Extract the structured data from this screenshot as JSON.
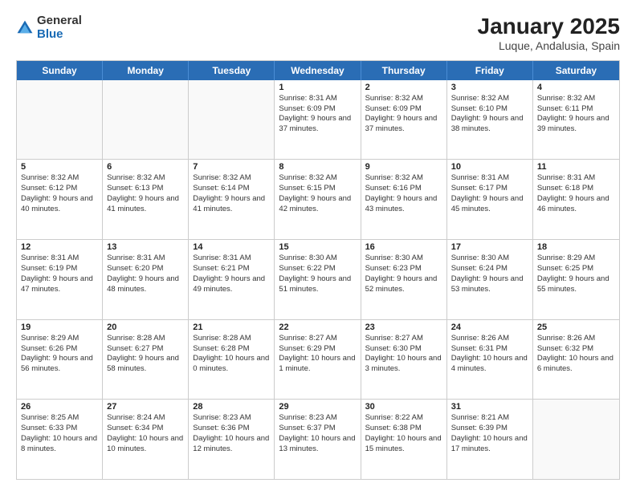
{
  "header": {
    "logo_general": "General",
    "logo_blue": "Blue",
    "title": "January 2025",
    "subtitle": "Luque, Andalusia, Spain"
  },
  "days_of_week": [
    "Sunday",
    "Monday",
    "Tuesday",
    "Wednesday",
    "Thursday",
    "Friday",
    "Saturday"
  ],
  "weeks": [
    [
      {
        "day": "",
        "empty": true
      },
      {
        "day": "",
        "empty": true
      },
      {
        "day": "",
        "empty": true
      },
      {
        "day": "1",
        "sunrise": "8:31 AM",
        "sunset": "6:09 PM",
        "daylight": "9 hours and 37 minutes."
      },
      {
        "day": "2",
        "sunrise": "8:32 AM",
        "sunset": "6:09 PM",
        "daylight": "9 hours and 37 minutes."
      },
      {
        "day": "3",
        "sunrise": "8:32 AM",
        "sunset": "6:10 PM",
        "daylight": "9 hours and 38 minutes."
      },
      {
        "day": "4",
        "sunrise": "8:32 AM",
        "sunset": "6:11 PM",
        "daylight": "9 hours and 39 minutes."
      }
    ],
    [
      {
        "day": "5",
        "sunrise": "8:32 AM",
        "sunset": "6:12 PM",
        "daylight": "9 hours and 40 minutes."
      },
      {
        "day": "6",
        "sunrise": "8:32 AM",
        "sunset": "6:13 PM",
        "daylight": "9 hours and 41 minutes."
      },
      {
        "day": "7",
        "sunrise": "8:32 AM",
        "sunset": "6:14 PM",
        "daylight": "9 hours and 41 minutes."
      },
      {
        "day": "8",
        "sunrise": "8:32 AM",
        "sunset": "6:15 PM",
        "daylight": "9 hours and 42 minutes."
      },
      {
        "day": "9",
        "sunrise": "8:32 AM",
        "sunset": "6:16 PM",
        "daylight": "9 hours and 43 minutes."
      },
      {
        "day": "10",
        "sunrise": "8:31 AM",
        "sunset": "6:17 PM",
        "daylight": "9 hours and 45 minutes."
      },
      {
        "day": "11",
        "sunrise": "8:31 AM",
        "sunset": "6:18 PM",
        "daylight": "9 hours and 46 minutes."
      }
    ],
    [
      {
        "day": "12",
        "sunrise": "8:31 AM",
        "sunset": "6:19 PM",
        "daylight": "9 hours and 47 minutes."
      },
      {
        "day": "13",
        "sunrise": "8:31 AM",
        "sunset": "6:20 PM",
        "daylight": "9 hours and 48 minutes."
      },
      {
        "day": "14",
        "sunrise": "8:31 AM",
        "sunset": "6:21 PM",
        "daylight": "9 hours and 49 minutes."
      },
      {
        "day": "15",
        "sunrise": "8:30 AM",
        "sunset": "6:22 PM",
        "daylight": "9 hours and 51 minutes."
      },
      {
        "day": "16",
        "sunrise": "8:30 AM",
        "sunset": "6:23 PM",
        "daylight": "9 hours and 52 minutes."
      },
      {
        "day": "17",
        "sunrise": "8:30 AM",
        "sunset": "6:24 PM",
        "daylight": "9 hours and 53 minutes."
      },
      {
        "day": "18",
        "sunrise": "8:29 AM",
        "sunset": "6:25 PM",
        "daylight": "9 hours and 55 minutes."
      }
    ],
    [
      {
        "day": "19",
        "sunrise": "8:29 AM",
        "sunset": "6:26 PM",
        "daylight": "9 hours and 56 minutes."
      },
      {
        "day": "20",
        "sunrise": "8:28 AM",
        "sunset": "6:27 PM",
        "daylight": "9 hours and 58 minutes."
      },
      {
        "day": "21",
        "sunrise": "8:28 AM",
        "sunset": "6:28 PM",
        "daylight": "10 hours and 0 minutes."
      },
      {
        "day": "22",
        "sunrise": "8:27 AM",
        "sunset": "6:29 PM",
        "daylight": "10 hours and 1 minute."
      },
      {
        "day": "23",
        "sunrise": "8:27 AM",
        "sunset": "6:30 PM",
        "daylight": "10 hours and 3 minutes."
      },
      {
        "day": "24",
        "sunrise": "8:26 AM",
        "sunset": "6:31 PM",
        "daylight": "10 hours and 4 minutes."
      },
      {
        "day": "25",
        "sunrise": "8:26 AM",
        "sunset": "6:32 PM",
        "daylight": "10 hours and 6 minutes."
      }
    ],
    [
      {
        "day": "26",
        "sunrise": "8:25 AM",
        "sunset": "6:33 PM",
        "daylight": "10 hours and 8 minutes."
      },
      {
        "day": "27",
        "sunrise": "8:24 AM",
        "sunset": "6:34 PM",
        "daylight": "10 hours and 10 minutes."
      },
      {
        "day": "28",
        "sunrise": "8:23 AM",
        "sunset": "6:36 PM",
        "daylight": "10 hours and 12 minutes."
      },
      {
        "day": "29",
        "sunrise": "8:23 AM",
        "sunset": "6:37 PM",
        "daylight": "10 hours and 13 minutes."
      },
      {
        "day": "30",
        "sunrise": "8:22 AM",
        "sunset": "6:38 PM",
        "daylight": "10 hours and 15 minutes."
      },
      {
        "day": "31",
        "sunrise": "8:21 AM",
        "sunset": "6:39 PM",
        "daylight": "10 hours and 17 minutes."
      },
      {
        "day": "",
        "empty": true
      }
    ]
  ]
}
